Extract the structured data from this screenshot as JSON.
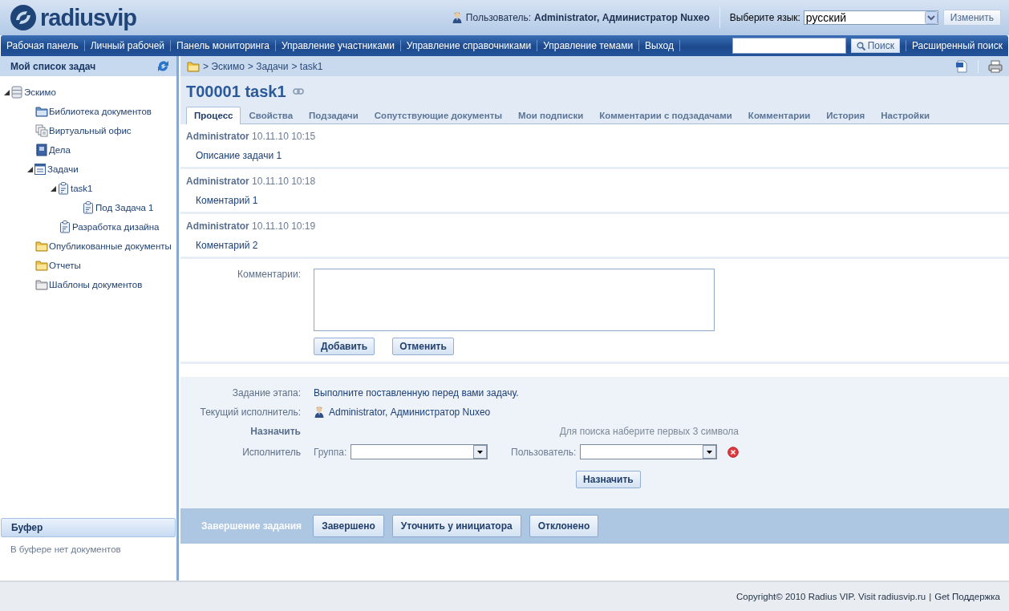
{
  "header": {
    "logo": "radiusvip",
    "user_label": "Пользователь:",
    "user_name": "Administrator, Администратор Nuxeo",
    "language_label": "Выберите язык:",
    "language": "русский",
    "change_button": "Изменить"
  },
  "nav": {
    "items": [
      "Рабочая панель",
      "Личный рабочей",
      "Панель мониторинга",
      "Управление участниками",
      "Управление справочниками",
      "Управление темами",
      "Выход"
    ],
    "search_button": "Поиск",
    "advanced_search": "Расширенный поиск"
  },
  "sidebar": {
    "title": "Мой список задач",
    "tree": [
      {
        "label": "Эскимо",
        "kind": "database",
        "expanded": true,
        "children": [
          {
            "label": "Библиотека документов",
            "kind": "library"
          },
          {
            "label": "Виртуальный офис",
            "kind": "pages"
          },
          {
            "label": "Дела",
            "kind": "book"
          },
          {
            "label": "Задачи",
            "kind": "list",
            "expanded": true,
            "children": [
              {
                "label": "task1",
                "kind": "task",
                "expanded": true,
                "children": [
                  {
                    "label": "Под Задача 1",
                    "kind": "task"
                  }
                ]
              },
              {
                "label": "Разработка дизайна",
                "kind": "task"
              }
            ]
          },
          {
            "label": "Опубликованные документы",
            "kind": "folder"
          },
          {
            "label": "Отчеты",
            "kind": "folder"
          },
          {
            "label": "Шаблоны документов",
            "kind": "templates"
          }
        ]
      }
    ],
    "buffer": {
      "title": "Буфер",
      "empty_text": "В буфере нет документов"
    }
  },
  "breadcrumb": [
    "> Эскимо",
    "> Задачи",
    "> task1"
  ],
  "task": {
    "title": "T00001 task1",
    "tabs": [
      {
        "label": "Процесс",
        "selected": true
      },
      {
        "label": "Свойства",
        "selected": false
      },
      {
        "label": "Подзадачи",
        "selected": false
      },
      {
        "label": "Сопутствующие документы",
        "selected": false
      },
      {
        "label": "Мои подписки",
        "selected": false
      },
      {
        "label": "Комментарии с подзадачами",
        "selected": false
      },
      {
        "label": "Комментарии",
        "selected": false
      },
      {
        "label": "История",
        "selected": false
      },
      {
        "label": "Настройки",
        "selected": false
      }
    ],
    "comments": [
      {
        "author": "Administrator",
        "time": "10.11.10 10:15",
        "text": "Описание задачи 1"
      },
      {
        "author": "Administrator",
        "time": "10.11.10 10:18",
        "text": "Коментарий 1"
      },
      {
        "author": "Administrator",
        "time": "10.11.10 10:19",
        "text": "Коментарий 2"
      }
    ],
    "comment_form": {
      "label": "Комментарии:",
      "add_button": "Добавить",
      "cancel_button": "Отменить"
    },
    "assignment": {
      "stage_label": "Задание этапа:",
      "stage_text": "Выполните поставленную перед вами задачу.",
      "current_label": "Текущий исполнитель:",
      "current_user": "Administrator, Администратор Nuxeo",
      "assign_heading": "Назначить",
      "search_hint": "Для поиска наберите первых 3 символа",
      "executor_label": "Исполнитель",
      "group_label": "Группа:",
      "user_label": "Пользователь:",
      "assign_button": "Назначить"
    },
    "completion": {
      "label": "Завершение задания",
      "buttons": [
        "Завершено",
        "Уточнить у инициатора",
        "Отклонено"
      ]
    }
  },
  "footer": {
    "copyright": "Copyright© 2010 Radius VIP. Visit radiusvip.ru",
    "separator": "|",
    "link": "Get Поддержка"
  }
}
